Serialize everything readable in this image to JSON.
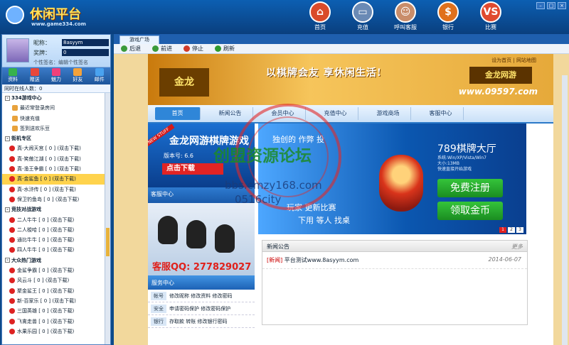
{
  "header": {
    "logo_title": "休闲平台",
    "logo_url": "www.game334.com",
    "nav": [
      {
        "label": "首页",
        "icon": "home-icon"
      },
      {
        "label": "充值",
        "icon": "card-icon"
      },
      {
        "label": "呼叫客服",
        "icon": "agent-icon"
      },
      {
        "label": "银行",
        "icon": "bank-icon"
      },
      {
        "label": "比赛",
        "icon": "vs-icon"
      }
    ]
  },
  "user": {
    "nickname_label": "昵称：",
    "nickname": "8asyym",
    "coin_label": "奖牌：",
    "coin": "0",
    "signature_label": "个性签名：",
    "signature": "编辑个性签名"
  },
  "tools": [
    "资料",
    "赠送",
    "魅力",
    "好友",
    "邮件"
  ],
  "online": "同时在线人数：0",
  "tree": [
    {
      "text": "334游戏中心",
      "level": "cat",
      "box": "-"
    },
    {
      "text": "最近常登录房间",
      "level": "l1"
    },
    {
      "text": "快速充值",
      "level": "l1"
    },
    {
      "text": "签到送欢乐豆",
      "level": "l1"
    },
    {
      "text": "街机专区",
      "level": "cat",
      "box": "-"
    },
    {
      "text": "真-大闹天宫 [ 0 ] (双击下载)",
      "level": "l2"
    },
    {
      "text": "真-笑傲江湖 [ 0 ] (双击下载)",
      "level": "l2"
    },
    {
      "text": "真-渔王争霸 [ 0 ] (双击下载)",
      "level": "l2"
    },
    {
      "text": "真-金鲨鱼 [ 0 ] (双击下载)",
      "level": "l2",
      "selected": true
    },
    {
      "text": "真-水浒传 [ 0 ] (双击下载)",
      "level": "l2"
    },
    {
      "text": "保卫钓鱼岛 [ 0 ] (双击下载)",
      "level": "l2"
    },
    {
      "text": "竞技对战游戏",
      "level": "cat",
      "box": "-"
    },
    {
      "text": "二人牛牛 [ 0 ] (双击下载)",
      "level": "l2"
    },
    {
      "text": "二人梭哈 [ 0 ] (双击下载)",
      "level": "l2"
    },
    {
      "text": "通比牛牛 [ 0 ] (双击下载)",
      "level": "l2"
    },
    {
      "text": "四人牛牛 [ 0 ] (双击下载)",
      "level": "l2"
    },
    {
      "text": "大众热门游戏",
      "level": "cat",
      "box": "-"
    },
    {
      "text": "金鲨争霸 [ 0 ] (双击下载)",
      "level": "l2"
    },
    {
      "text": "风云斗 [ 0 ] (双击下载)",
      "level": "l2"
    },
    {
      "text": "聚金鲨王 [ 0 ] (双击下载)",
      "level": "l2"
    },
    {
      "text": "新-百家乐 [ 0 ] (双击下载)",
      "level": "l2"
    },
    {
      "text": "三国英雄 [ 0 ] (双击下载)",
      "level": "l2"
    },
    {
      "text": "飞禽走兽 [ 0 ] (双击下载)",
      "level": "l2"
    },
    {
      "text": "水果乐园 [ 0 ] (双击下载)",
      "level": "l2"
    }
  ],
  "tab": "游戏广场",
  "browser": {
    "back": "后退",
    "forward": "前进",
    "stop": "停止",
    "refresh": "刷新"
  },
  "site": {
    "logo": "金龙",
    "slogan": "以棋牌会友 享休闲生活!",
    "toplinks": "设为首页 | 网站地图",
    "brand": "金龙网游",
    "url": "www.09597.com",
    "menu": [
      "首页",
      "新闻公告",
      "会员中心",
      "充值中心",
      "游戏商场",
      "客服中心"
    ],
    "promo": {
      "badge": "NEW STUFF",
      "title": "金龙网游棋牌游戏",
      "version": "版本号: 6.6",
      "cta": "点击下载"
    },
    "slider": {
      "line1": "独创的 作弊 投",
      "line2": "玩家 更新比赛",
      "line3": "下用 等人 找桌",
      "brand": "789棋牌大厅",
      "sys": "系统:Win/XP/Vista/Win7",
      "size": "大小:13MB",
      "fast": "快速直接开始游戏",
      "register": "免费注册",
      "gold": "领取金币",
      "pages": [
        "1",
        "2",
        "3"
      ]
    },
    "service_title": "客服中心",
    "qq": "客服QQ: 277829027",
    "svc_title": "服务中心",
    "svc": [
      {
        "tag": "帐号",
        "items": "修改昵称  修改资料  修改密码"
      },
      {
        "tag": "安全",
        "items": "申请密码保护  修改密码保护"
      },
      {
        "tag": "银行",
        "items": "存取款  转账  修改银行密码"
      }
    ],
    "news_title": "新闻公告",
    "news_more": "更多",
    "news": [
      {
        "tag": "[新闻]",
        "text": "平台测试www.8asyym.com",
        "date": "2014-06-07"
      }
    ]
  },
  "watermark": {
    "main": "创盟资源论坛",
    "url": "bbs.cmzy168.com",
    "sub": "0516city"
  }
}
